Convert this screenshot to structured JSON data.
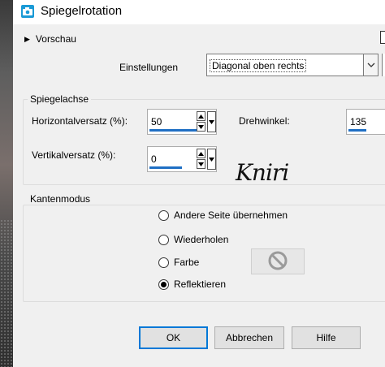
{
  "window": {
    "title": "Spiegelrotation"
  },
  "preview": {
    "label": "Vorschau"
  },
  "settings": {
    "label": "Einstellungen",
    "value": "Diagonal oben rechts"
  },
  "mirror_axis": {
    "title": "Spiegelachse",
    "horizontal_label": "Horizontalversatz (%):",
    "horizontal_value": "50",
    "vertical_label": "Vertikalversatz (%):",
    "vertical_value": "0",
    "rotation_label": "Drehwinkel:",
    "rotation_value": "135"
  },
  "signature": {
    "text": "Kniri"
  },
  "edge_mode": {
    "title": "Kantenmodus",
    "options": [
      {
        "label": "Andere Seite übernehmen",
        "checked": false
      },
      {
        "label": "Wiederholen",
        "checked": false
      },
      {
        "label": "Farbe",
        "checked": false
      },
      {
        "label": "Reflektieren",
        "checked": true
      }
    ]
  },
  "buttons": {
    "ok": "OK",
    "cancel": "Abbrechen",
    "help": "Hilfe"
  },
  "colors": {
    "accent": "#0078d7",
    "icon": "#1a9ad6",
    "slider": "#1f6fc4"
  },
  "icons": {
    "app": "camera-icon",
    "swatch": "no-color-icon"
  }
}
